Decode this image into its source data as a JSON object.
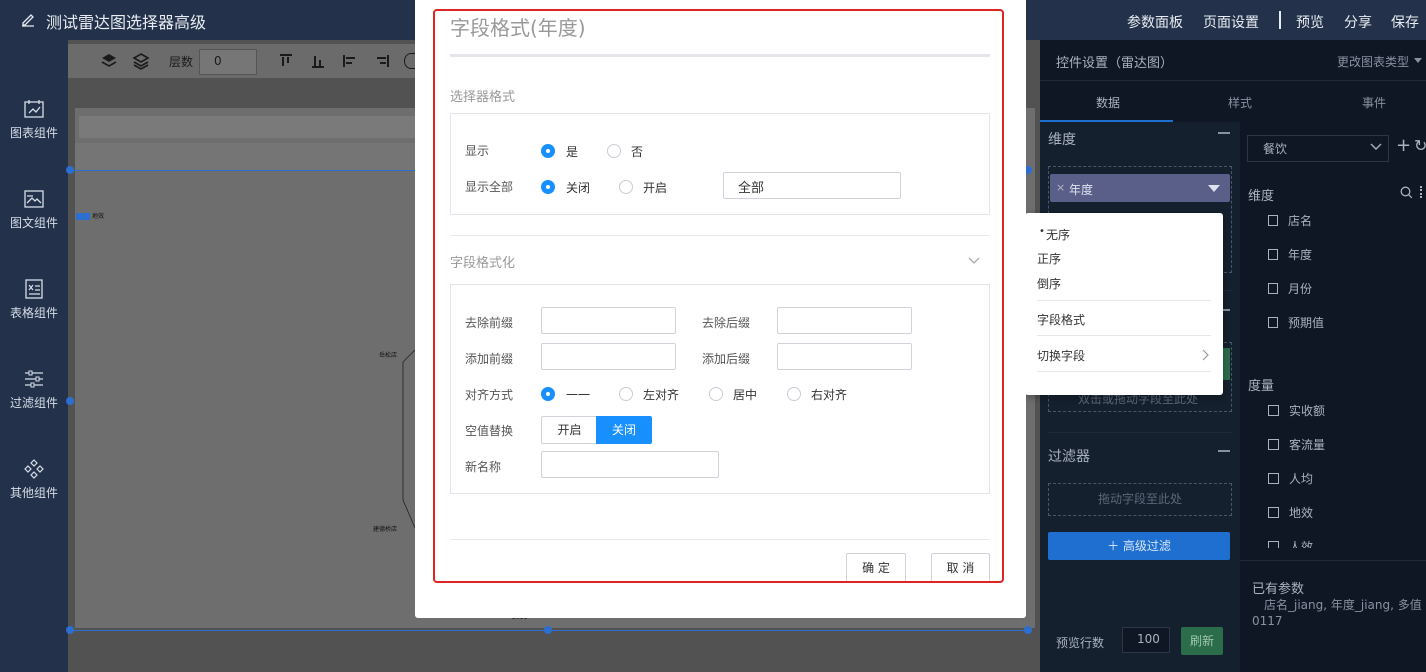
{
  "topbar": {
    "title": "测试雷达图选择器高级",
    "actions": [
      "参数面板",
      "页面设置",
      "预览",
      "分享",
      "保存"
    ]
  },
  "rail": {
    "items": [
      {
        "label": "图表组件",
        "icon": "chart-icon"
      },
      {
        "label": "图文组件",
        "icon": "image-text-icon"
      },
      {
        "label": "表格组件",
        "icon": "table-icon"
      },
      {
        "label": "过滤组件",
        "icon": "filter-icon"
      },
      {
        "label": "其他组件",
        "icon": "other-icon"
      }
    ]
  },
  "toolbar": {
    "layer_label": "层数",
    "layer_value": "0"
  },
  "canvas": {
    "legend_label": "地效",
    "label_a": "岳松店",
    "label_b": "建德桥店",
    "label_c": "2011"
  },
  "right_panel": {
    "title": "控件设置（雷达图）",
    "change_type": "更改图表类型",
    "tabs": [
      "数据",
      "样式",
      "事件"
    ],
    "dimension_title": "维度",
    "dimension_chip": "年度",
    "drop_hint": "双击或拖动字段至此处",
    "filter_title": "过滤器",
    "filter_hint": "拖动字段至此处",
    "adv_filter": "＋ 高级过滤",
    "dataset_select": "餐饮",
    "fields_dim_title": "维度",
    "dim_fields": [
      "店名",
      "年度",
      "月份",
      "预期值"
    ],
    "measure_title": "度量",
    "measure_fields": [
      "实收额",
      "客流量",
      "人均",
      "地效",
      "人效"
    ],
    "params_title": "已有参数",
    "params_text": "店名_jiang, 年度_jiang, 多值",
    "params_text2": "0117",
    "preview_rows_label": "预览行数",
    "preview_rows_value": "100",
    "refresh": "刷新"
  },
  "menu": {
    "items": [
      "无序",
      "正序",
      "倒序",
      "字段格式",
      "切换字段"
    ]
  },
  "modal": {
    "title": "字段格式(年度)",
    "selector_section": "选择器格式",
    "show_label": "显示",
    "show_yes": "是",
    "show_no": "否",
    "show_all_label": "显示全部",
    "show_all_off": "关闭",
    "show_all_on": "开启",
    "all_value": "全部",
    "format_section": "字段格式化",
    "remove_prefix": "去除前缀",
    "remove_suffix": "去除后缀",
    "add_prefix": "添加前缀",
    "add_suffix": "添加后缀",
    "align_label": "对齐方式",
    "align_options": [
      "一一",
      "左对齐",
      "居中",
      "右对齐"
    ],
    "null_replace_label": "空值替换",
    "toggle_on": "开启",
    "toggle_off": "关闭",
    "new_name_label": "新名称",
    "ok": "确 定",
    "cancel": "取 消"
  },
  "colors": {
    "accent": "#1890ff",
    "header": "#23324a",
    "highlight": "#e02323"
  }
}
